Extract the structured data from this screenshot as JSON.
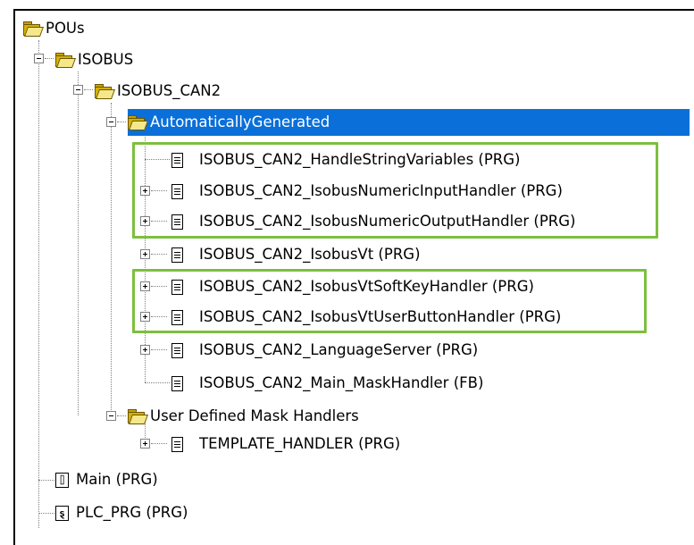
{
  "tree": {
    "root": {
      "label": "POUs"
    },
    "isobus": {
      "label": "ISOBUS"
    },
    "isobus_can2": {
      "label": "ISOBUS_CAN2"
    },
    "auto_generated": {
      "label": "AutomaticallyGenerated",
      "items": [
        {
          "label": "ISOBUS_CAN2_HandleStringVariables (PRG)"
        },
        {
          "label": "ISOBUS_CAN2_IsobusNumericInputHandler (PRG)"
        },
        {
          "label": "ISOBUS_CAN2_IsobusNumericOutputHandler (PRG)"
        },
        {
          "label": "ISOBUS_CAN2_IsobusVt (PRG)"
        },
        {
          "label": "ISOBUS_CAN2_IsobusVtSoftKeyHandler (PRG)"
        },
        {
          "label": "ISOBUS_CAN2_IsobusVtUserButtonHandler (PRG)"
        },
        {
          "label": "ISOBUS_CAN2_LanguageServer (PRG)"
        },
        {
          "label": "ISOBUS_CAN2_Main_MaskHandler (FB)"
        }
      ]
    },
    "user_defined": {
      "label": "User Defined Mask Handlers",
      "items": [
        {
          "label": "TEMPLATE_HANDLER (PRG)"
        }
      ]
    },
    "main": {
      "label": "Main (PRG)",
      "icon": "program-icon",
      "glyph": "⌷"
    },
    "plc_prg": {
      "label": "PLC_PRG (PRG)",
      "icon": "sfc-program-icon",
      "glyph": "ȿ"
    }
  },
  "colors": {
    "selection": "#0a6fd8",
    "highlight_border": "#7dbf3f"
  },
  "selected_item": "AutomaticallyGenerated"
}
